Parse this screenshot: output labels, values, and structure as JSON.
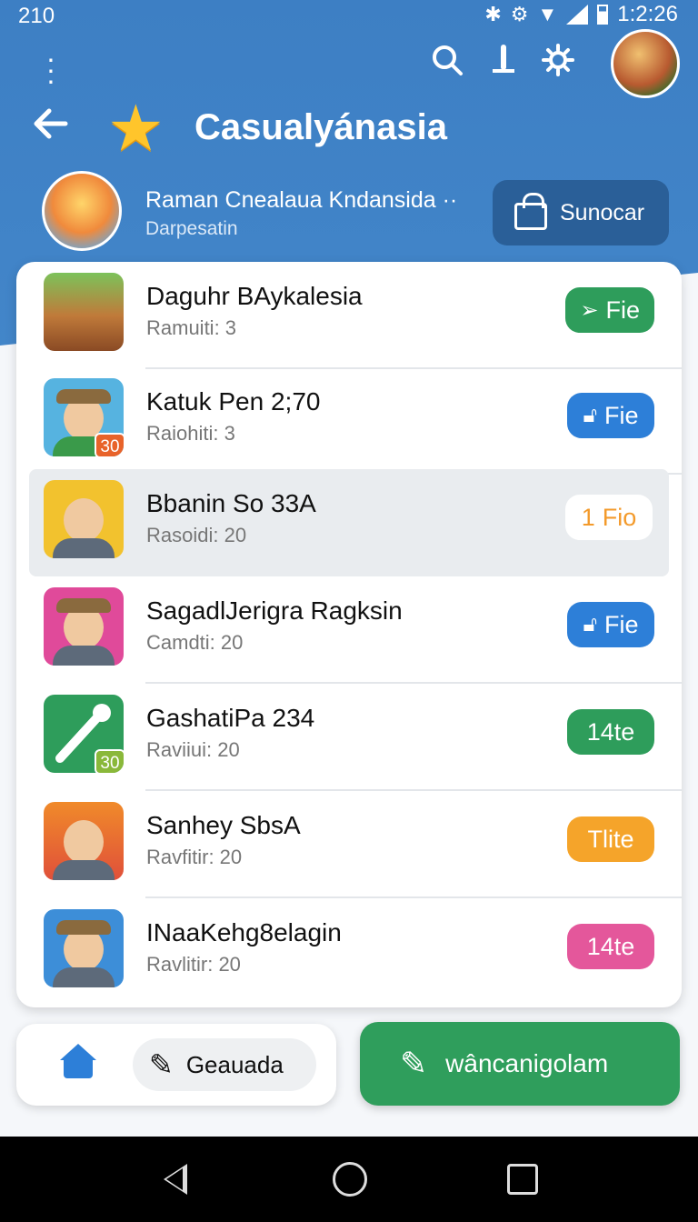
{
  "status": {
    "left": "210",
    "time": "1:2:26"
  },
  "header": {
    "title": "Casualyánasia"
  },
  "profile": {
    "name": "Raman Cnealaua Kndansida ··",
    "subtitle": "Darpesatin",
    "action_label": "Sunocar"
  },
  "items": [
    {
      "name": "Daguhr BAykalesia",
      "meta": "Ramuiti:  3",
      "action": "Fie",
      "action_icon": "send-icon",
      "color": "#2e9d5b",
      "badge": ""
    },
    {
      "name": "Katuk Pen 2;70",
      "meta": "Raiohiti:  3",
      "action": "Fie",
      "action_icon": "unlock-icon",
      "color": "#2d7fd8",
      "badge": "30",
      "badge_color": "#e8632a"
    },
    {
      "name": "Bbanin So 33A",
      "meta": "Rasoidi: 20",
      "action": "Fio",
      "action_prefix": "1",
      "color": "#ffffff",
      "text_color": "#f39a2b",
      "badge": "",
      "selected": true
    },
    {
      "name": "SagadlJerigra Ragksin",
      "meta": "Camdti: 20",
      "action": "Fie",
      "action_icon": "unlock-icon",
      "color": "#2d7fd8",
      "badge": ""
    },
    {
      "name": "GashatiPa 234",
      "meta": "Raviiui: 20",
      "action": "14te",
      "color": "#2e9d5b",
      "badge": "30",
      "badge_color": "#8ab83a"
    },
    {
      "name": "Sanhey SbsA",
      "meta": "Ravfitir: 20",
      "action": "Tlite",
      "color": "#f5a42a",
      "badge": ""
    },
    {
      "name": "INaaKehg8elagin",
      "meta": "Ravlitir: 20",
      "action": "14te",
      "color": "#e4579b",
      "badge": ""
    }
  ],
  "bottom": {
    "draft_label": "Geauada",
    "compose_label": "wâncanigolam"
  }
}
